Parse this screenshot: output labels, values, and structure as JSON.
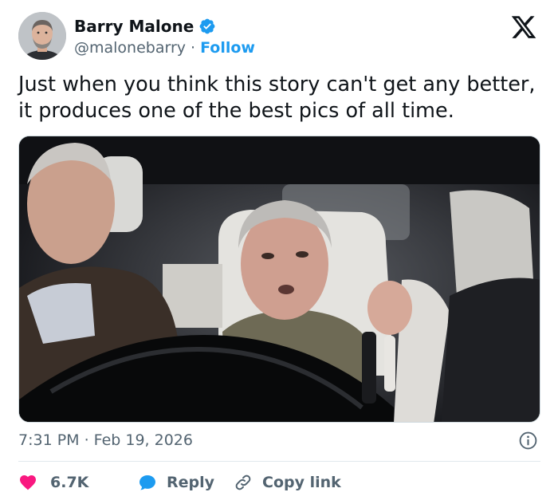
{
  "author": {
    "display_name": "Barry Malone",
    "handle": "@malonebarry",
    "separator": "·",
    "follow_label": "Follow",
    "verified": true
  },
  "tweet": {
    "text_line1": "Just when you think this story can't get any better,",
    "text_line2": "it produces one of the best pics of all time."
  },
  "meta": {
    "timestamp": "7:31 PM · Feb 19, 2026"
  },
  "actions": {
    "like_count": "6.7K",
    "reply_label": "Reply",
    "copy_label": "Copy link"
  },
  "icons": {
    "verified": "verified-badge-icon",
    "logo": "x-logo-icon",
    "info": "info-icon",
    "like": "heart-icon",
    "reply": "speech-bubble-icon",
    "copy": "link-icon"
  },
  "colors": {
    "accent": "#1d9bf0",
    "like": "#f91880",
    "text": "#0f1419",
    "muted": "#536471"
  }
}
